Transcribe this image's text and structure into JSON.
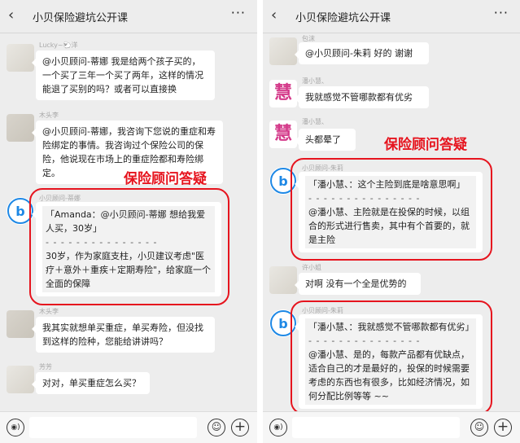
{
  "left": {
    "title": "小贝保险避坑公开课",
    "back": "‹",
    "more": "···",
    "annotation": "保险顾问答疑",
    "messages": [
      {
        "name": "Lucky~🐑洋",
        "text": "@小贝顾问-蒂娜  我是给两个孩子买的，一个买了三年一个买了两年，这样的情况能退了买别的吗？或者可以直接换"
      },
      {
        "name": "木头李",
        "text": "@小贝顾问-蒂娜，我咨询下您说的重症和寿险绑定的事情。我咨询过个保险公司的保险，他说现在市场上的重症险都和寿险绑定。"
      },
      {
        "name": "小贝顾问-蒂娜",
        "quote": "「Amanda：@小贝顾问-蒂娜  想给我爱人买，30岁」",
        "dash": "- - - - - - - - - - - - - - -",
        "text": "30岁，作为家庭支柱，小贝建议考虑\"医疗＋意外＋重疾＋定期寿险\"，给家庭一个全面的保障"
      },
      {
        "name": "木头李",
        "text": "我其实就想单买重症，单买寿险，但没找到这样的险种，您能给讲讲吗？"
      },
      {
        "name": "芳芳",
        "text": "对对，单买重症怎么买？"
      }
    ]
  },
  "right": {
    "title": "小贝保险避坑公开课",
    "back": "‹",
    "more": "···",
    "annotation": "保险顾问答疑",
    "messages": [
      {
        "name": "包沫",
        "text": "@小贝顾问-朱莉  好的 谢谢"
      },
      {
        "name": "潘小慧、",
        "text": "我就感觉不管哪款都有优劣"
      },
      {
        "name": "潘小慧、",
        "text": "头都晕了"
      },
      {
        "name": "小贝顾问-朱莉",
        "quote": "「潘小慧、：这个主险到底是啥意思啊」",
        "dash": "- - - - - - - - - - - - - - -",
        "text": "@潘小慧、主险就是在投保的时候，以组合的形式进行售卖，其中有个首要的，就是主险"
      },
      {
        "name": "许小姐",
        "text": "对啊 没有一个全是优势的"
      },
      {
        "name": "小贝顾问-朱莉",
        "quote": "「潘小慧、：我就感觉不管哪款都有优劣」",
        "dash": "- - - - - - - - - - - - - - -",
        "text": "@潘小慧、是的，每款产品都有优缺点，适合自己的才是最好的，投保的时候需要考虑的东西也有很多，比如经济情况，如何分配比例等等 ~~"
      }
    ]
  },
  "input": {
    "voice_icon": "voice-icon",
    "emoji_icon": "emoji-icon",
    "plus_icon": "plus-icon"
  },
  "colors": {
    "accent_red": "#e6141e",
    "brand_blue": "#1e88e5",
    "avatar_pink": "#d43a8a",
    "background": "#ededed"
  }
}
